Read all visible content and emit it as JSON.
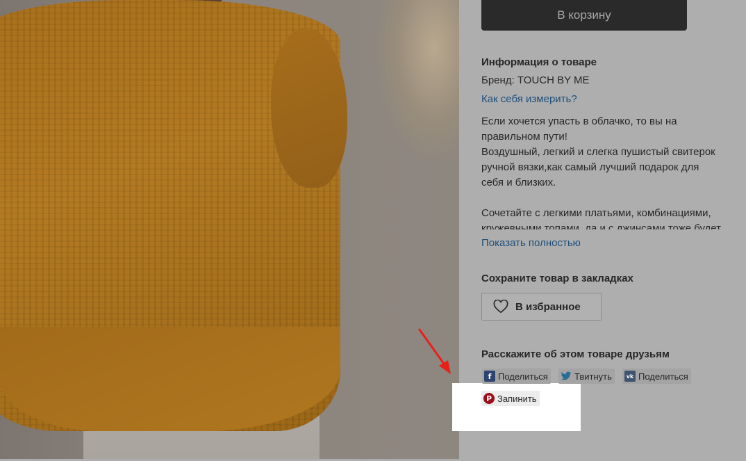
{
  "cart": {
    "label": "В корзину"
  },
  "product_info": {
    "title": "Информация о товаре",
    "brand": "Бренд: TOUCH BY ME",
    "measure_link": "Как себя измерить?",
    "description": {
      "line1": "Если хочется упасть в облачко, то вы на",
      "line2": "правильном пути!",
      "line3": "Воздушный, легкий и слегка пушистый свитерок",
      "line4": "ручной вязки,как самый лучший подарок для",
      "line5": "себя и близких.",
      "line6": "Сочетайте с легкими платьями, комбинациями,",
      "line7": "кружевными топами, да и с джинсами тоже будет"
    },
    "show_more": "Показать полностью"
  },
  "bookmarks": {
    "title": "Сохраните товар в закладках",
    "favorite_label": "В избранное",
    "favorite_icon": "heart-icon"
  },
  "share": {
    "title": "Расскажите об этом товаре друзьям",
    "facebook": {
      "label": "Поделиться",
      "icon": "facebook-icon",
      "glyph": "f",
      "color": "#2e4470"
    },
    "twitter": {
      "label": "Твитнуть",
      "icon": "twitter-icon",
      "color": "#2a6c93"
    },
    "vk": {
      "label": "Поделиться",
      "icon": "vk-icon",
      "glyph": "vk",
      "color": "#3f5470"
    },
    "pinterest": {
      "label": "Запинить",
      "icon": "pinterest-icon",
      "glyph": "P",
      "color": "#9e0c1a"
    }
  },
  "annotation": {
    "arrow_color": "#e8201a"
  }
}
